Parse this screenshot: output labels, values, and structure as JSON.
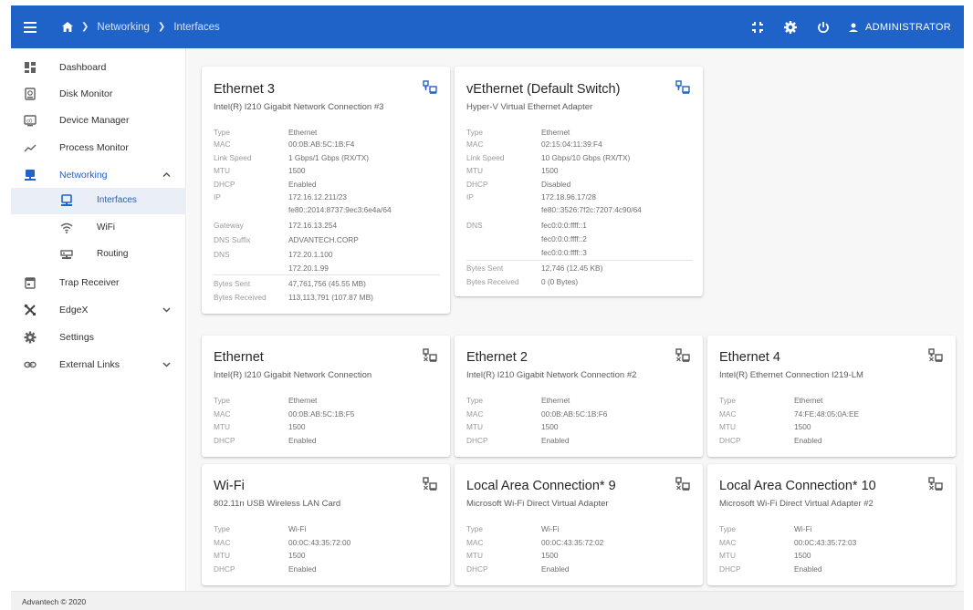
{
  "header": {
    "breadcrumb": [
      "Networking",
      "Interfaces"
    ],
    "user_label": "ADMINISTRATOR",
    "accent_color": "#1f62c8"
  },
  "sidebar": {
    "items": [
      {
        "label": "Dashboard",
        "icon": "dashboard-icon"
      },
      {
        "label": "Disk Monitor",
        "icon": "disk-icon"
      },
      {
        "label": "Device Manager",
        "icon": "device-manager-icon"
      },
      {
        "label": "Process Monitor",
        "icon": "process-monitor-icon"
      },
      {
        "label": "Networking",
        "icon": "networking-icon"
      },
      {
        "label": "Trap Receiver",
        "icon": "trap-receiver-icon"
      },
      {
        "label": "EdgeX",
        "icon": "edgex-icon"
      },
      {
        "label": "Settings",
        "icon": "settings-icon"
      },
      {
        "label": "External Links",
        "icon": "external-links-icon"
      }
    ],
    "networking_sub": [
      {
        "label": "Interfaces",
        "icon": "interfaces-icon"
      },
      {
        "label": "WiFi",
        "icon": "wifi-icon"
      },
      {
        "label": "Routing",
        "icon": "routing-icon"
      }
    ]
  },
  "cards": [
    {
      "title": "Ethernet 3",
      "subtitle": "Intel(R) I210 Gigabit Network Connection #3",
      "rows": [
        [
          "Type",
          "Ethernet"
        ],
        [
          "MAC",
          "00:0B:AB:5C:1B:F4"
        ],
        [
          "Link Speed",
          "1 Gbps/1 Gbps (RX/TX)"
        ],
        [
          "MTU",
          "1500"
        ],
        [
          "DHCP",
          "Enabled"
        ],
        [
          "IP",
          "172.16.12.211/23"
        ],
        [
          "",
          "fe80::2014:8737:9ec3:6e4a/64"
        ],
        [
          "Gateway",
          "172.16.13.254"
        ],
        [
          "DNS Suffix",
          "ADVANTECH.CORP"
        ],
        [
          "DNS",
          "172.20.1.100"
        ],
        [
          "",
          "172.20.1.99"
        ]
      ],
      "traffic": [
        [
          "Bytes Sent",
          "47,761,756 (45.55 MB)"
        ],
        [
          "Bytes Received",
          "113,113,791 (107.87 MB)"
        ]
      ]
    },
    {
      "title": "vEthernet (Default Switch)",
      "subtitle": "Hyper-V Virtual Ethernet Adapter",
      "rows": [
        [
          "Type",
          "Ethernet"
        ],
        [
          "MAC",
          "02:15:04:11:39:F4"
        ],
        [
          "Link Speed",
          "10 Gbps/10 Gbps (RX/TX)"
        ],
        [
          "MTU",
          "1500"
        ],
        [
          "DHCP",
          "Disabled"
        ],
        [
          "IP",
          "172.18.96.17/28"
        ],
        [
          "",
          "fe80::3526:7f2c:7207:4c90/64"
        ],
        [
          "DNS",
          "fec0:0:0:ffff::1"
        ],
        [
          "",
          "fec0:0:0:ffff::2"
        ],
        [
          "",
          "fec0:0:0:ffff::3"
        ]
      ],
      "traffic": [
        [
          "Bytes Sent",
          "12,746 (12.45 KB)"
        ],
        [
          "Bytes Received",
          "0 (0 Bytes)"
        ]
      ]
    },
    {
      "title": "Ethernet",
      "subtitle": "Intel(R) I210 Gigabit Network Connection",
      "rows": [
        [
          "Type",
          "Ethernet"
        ],
        [
          "MAC",
          "00:0B:AB:5C:1B:F5"
        ],
        [
          "MTU",
          "1500"
        ],
        [
          "DHCP",
          "Enabled"
        ]
      ]
    },
    {
      "title": "Ethernet 2",
      "subtitle": "Intel(R) I210 Gigabit Network Connection #2",
      "rows": [
        [
          "Type",
          "Ethernet"
        ],
        [
          "MAC",
          "00:0B:AB:5C:1B:F6"
        ],
        [
          "MTU",
          "1500"
        ],
        [
          "DHCP",
          "Enabled"
        ]
      ]
    },
    {
      "title": "Ethernet 4",
      "subtitle": "Intel(R) Ethernet Connection I219-LM",
      "rows": [
        [
          "Type",
          "Ethernet"
        ],
        [
          "MAC",
          "74:FE:48:05:0A:EE"
        ],
        [
          "MTU",
          "1500"
        ],
        [
          "DHCP",
          "Enabled"
        ]
      ]
    },
    {
      "title": "Wi-Fi",
      "subtitle": "802.11n USB Wireless LAN Card",
      "rows": [
        [
          "Type",
          "Wi-Fi"
        ],
        [
          "MAC",
          "00:0C:43:35:72:00"
        ],
        [
          "MTU",
          "1500"
        ],
        [
          "DHCP",
          "Enabled"
        ]
      ]
    },
    {
      "title": "Local Area Connection* 9",
      "subtitle": "Microsoft Wi-Fi Direct Virtual Adapter",
      "rows": [
        [
          "Type",
          "Wi-Fi"
        ],
        [
          "MAC",
          "00:0C:43:35:72:02"
        ],
        [
          "MTU",
          "1500"
        ],
        [
          "DHCP",
          "Enabled"
        ]
      ]
    },
    {
      "title": "Local Area Connection* 10",
      "subtitle": "Microsoft Wi-Fi Direct Virtual Adapter #2",
      "rows": [
        [
          "Type",
          "Wi-Fi"
        ],
        [
          "MAC",
          "00:0C:43:35:72:03"
        ],
        [
          "MTU",
          "1500"
        ],
        [
          "DHCP",
          "Enabled"
        ]
      ]
    }
  ],
  "footer": {
    "text": "Advantech © 2020"
  }
}
